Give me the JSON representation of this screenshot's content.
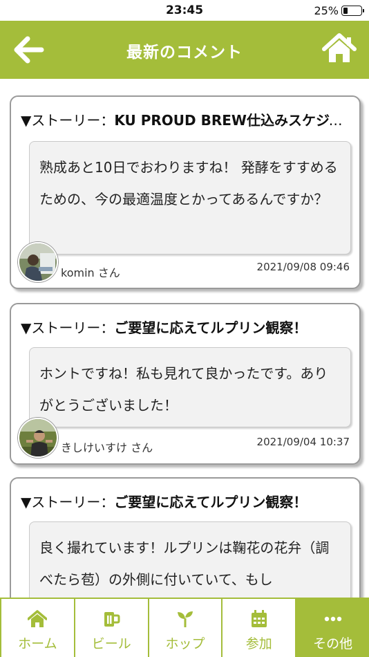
{
  "status_bar": {
    "time": "23:45",
    "battery_pct": "25%",
    "battery_level": 0.25
  },
  "header": {
    "title": "最新のコメント"
  },
  "comments": [
    {
      "prefix": "▼ストーリー：",
      "story": "KU PROUD BREW仕込みスケジュール",
      "body": "熟成あと10日でおわりますね！ 発酵をすすめるための、今の最適温度とかってあるんですか？",
      "author": "komin さん",
      "date": "2021/09/08 09:46"
    },
    {
      "prefix": "▼ストーリー：",
      "story": "ご要望に応えてルプリン観察！",
      "body": "ホントですね！私も見れて良かったです。ありがとうございました！",
      "author": "きしけいすけ さん",
      "date": "2021/09/04 10:37"
    },
    {
      "prefix": "▼ストーリー：",
      "story": "ご要望に応えてルプリン観察！",
      "body": "良く撮れています！ルプリンは鞠花の花弁（調べたら苞）の外側に付いていて、もし",
      "author": "",
      "date": ""
    }
  ],
  "tabbar": {
    "items": [
      {
        "label": "ホーム",
        "icon": "home-icon"
      },
      {
        "label": "ビール",
        "icon": "beer-mug-icon"
      },
      {
        "label": "ホップ",
        "icon": "sprout-icon"
      },
      {
        "label": "参加",
        "icon": "calendar-icon"
      },
      {
        "label": "その他",
        "icon": "more-dots-icon"
      }
    ]
  },
  "colors": {
    "accent": "#a4bd3a",
    "bubble": "#f2f2f2"
  }
}
